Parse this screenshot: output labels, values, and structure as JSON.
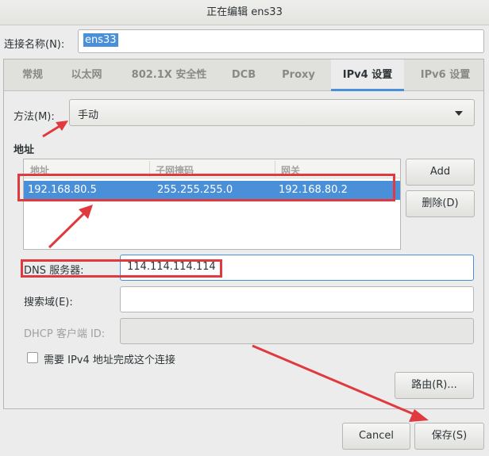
{
  "window": {
    "title": "正在编辑 ens33"
  },
  "connection": {
    "label": "连接名称(N):",
    "value": "ens33"
  },
  "tabs": [
    {
      "label": "常规"
    },
    {
      "label": "以太网"
    },
    {
      "label": "802.1X 安全性"
    },
    {
      "label": "DCB"
    },
    {
      "label": "Proxy"
    },
    {
      "label": "IPv4 设置",
      "active": true
    },
    {
      "label": "IPv6 设置"
    }
  ],
  "method": {
    "label": "方法(M):",
    "value": "手动"
  },
  "addresses": {
    "title": "地址",
    "columns": [
      "地址",
      "子网掩码",
      "网关"
    ],
    "rows": [
      {
        "address": "192.168.80.5",
        "netmask": "255.255.255.0",
        "gateway": "192.168.80.2"
      }
    ],
    "add_label": "Add",
    "delete_label": "删除(D)"
  },
  "dns": {
    "label": "DNS 服务器:",
    "value": "114.114.114.114"
  },
  "search_domains": {
    "label": "搜索域(E):",
    "value": ""
  },
  "dhcp_client_id": {
    "label": "DHCP 客户端 ID:",
    "value": ""
  },
  "require_ipv4": {
    "label": "需要 IPv4 地址完成这个连接",
    "checked": false
  },
  "routes_label": "路由(R)...",
  "cancel_label": "Cancel",
  "save_label": "保存(S)",
  "colors": {
    "accent": "#4a90d9",
    "annotation": "#e0393e"
  }
}
